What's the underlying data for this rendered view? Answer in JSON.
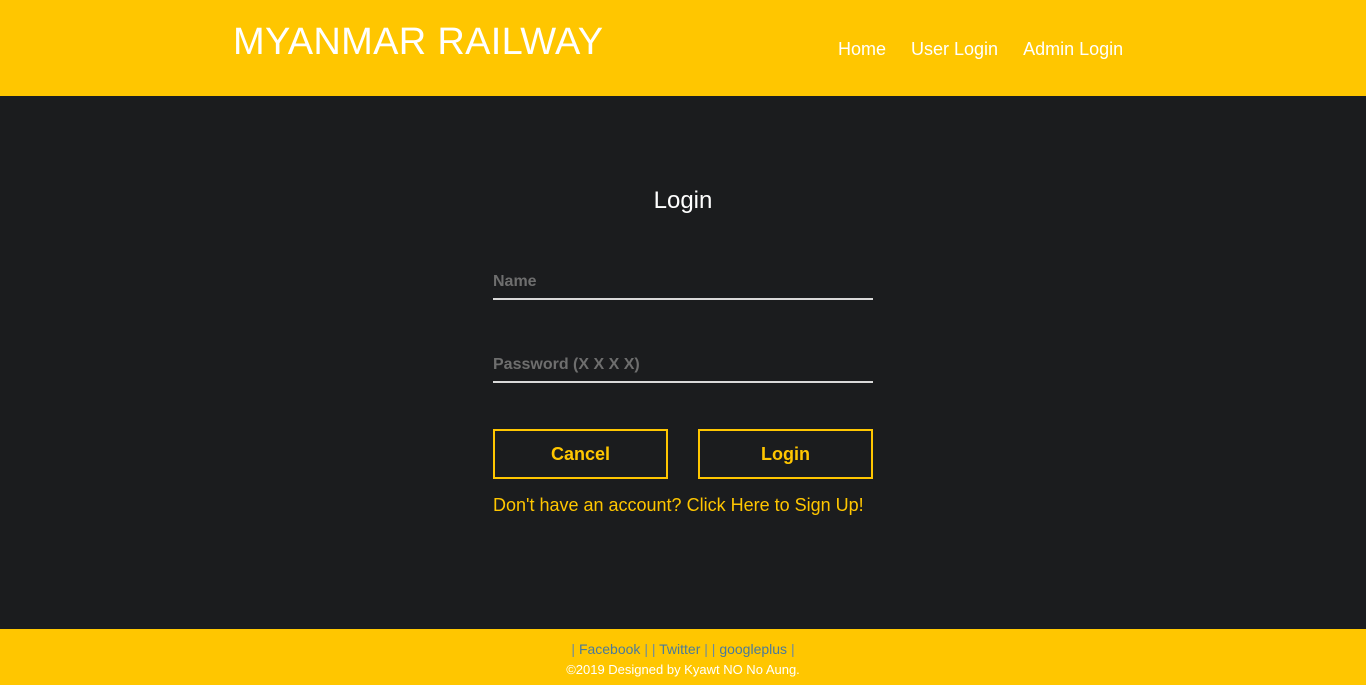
{
  "header": {
    "brand": "MYANMAR RAILWAY",
    "nav": [
      {
        "label": "Home"
      },
      {
        "label": "User Login"
      },
      {
        "label": "Admin Login"
      }
    ]
  },
  "login": {
    "title": "Login",
    "name_placeholder": "Name",
    "name_value": "",
    "password_placeholder": "Password (X X X X)",
    "password_value": "",
    "cancel_label": "Cancel",
    "login_label": "Login",
    "signup_text": "Don't have an account? Click Here to Sign Up!"
  },
  "footer": {
    "sep_open": "|",
    "sep_mid": "| |",
    "sep_close": "|",
    "links": [
      {
        "label": "Facebook"
      },
      {
        "label": "Twitter"
      },
      {
        "label": "googleplus"
      }
    ],
    "copyright": "©2019 Designed by Kyawt NO No Aung."
  },
  "colors": {
    "accent": "#ffc600",
    "background": "#1b1c1e",
    "text": "#ffffff"
  }
}
